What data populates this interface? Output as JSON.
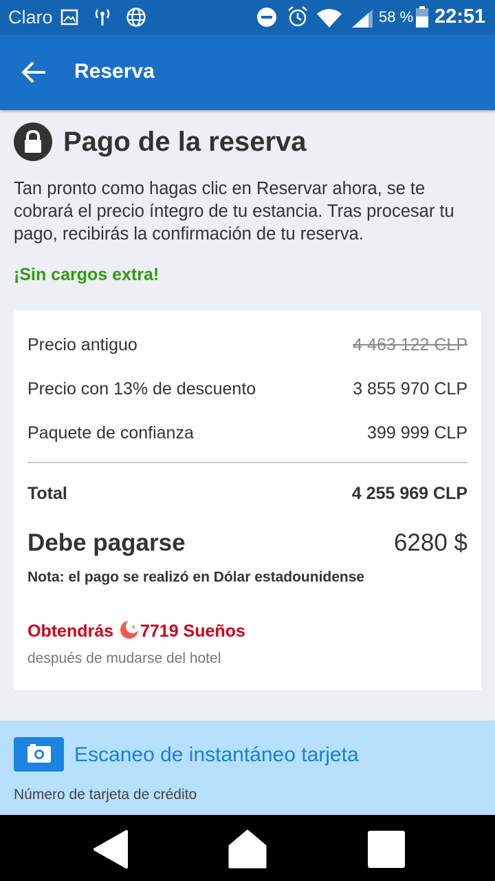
{
  "status_bar": {
    "carrier": "Claro",
    "battery_percent": "58 %",
    "time": "22:51",
    "icons": [
      "image-icon",
      "signal-tower-icon",
      "globe-icon",
      "do-not-disturb-icon",
      "alarm-icon",
      "wifi-icon",
      "cell-signal-icon",
      "battery-icon"
    ]
  },
  "app_bar": {
    "title": "Reserva",
    "back_icon": "arrow-left-icon"
  },
  "payment": {
    "heading": "Pago de la reserva",
    "lock_icon": "lock-icon",
    "intro": "Tan pronto como hagas clic en Reservar ahora, se te cobrará el precio íntegro de tu estancia. Tras procesar tu pago, recibirás la confirmación de tu reserva.",
    "no_extra_charges": "¡Sin cargos extra!",
    "no_extra_charges_color": "#2f9b0e"
  },
  "summary": {
    "old_price_label": "Precio antiguo",
    "old_price_value": "4 463 122 CLP",
    "discount_label": "Precio con 13% de descuento",
    "discount_value": "3 855 970 CLP",
    "package_label": "Paquete de confianza",
    "package_value": "399 999 CLP",
    "total_label": "Total",
    "total_value": "4 255 969 CLP",
    "due_label": "Debe pagarse",
    "due_value": "6280 $",
    "note": "Nota: el pago se realizó en Dólar estadounidense",
    "rewards_prefix": "Obtendrás",
    "rewards_value": "7719 Sueños",
    "rewards_icon": "moon-icon",
    "rewards_color": "#d0021b",
    "rewards_note": "después de mudarse del hotel"
  },
  "card_scan": {
    "button_icon": "camera-icon",
    "label": "Escaneo de instantáneo tarjeta",
    "card_number_label": "Número de tarjeta de crédito"
  },
  "nav_bar": {
    "buttons": [
      "back-triangle-icon",
      "home-icon",
      "recents-square-icon"
    ]
  },
  "colors": {
    "app_bar": "#1a6fc7",
    "status_bar": "#1464b4",
    "accent_blue": "#1a84e0"
  }
}
